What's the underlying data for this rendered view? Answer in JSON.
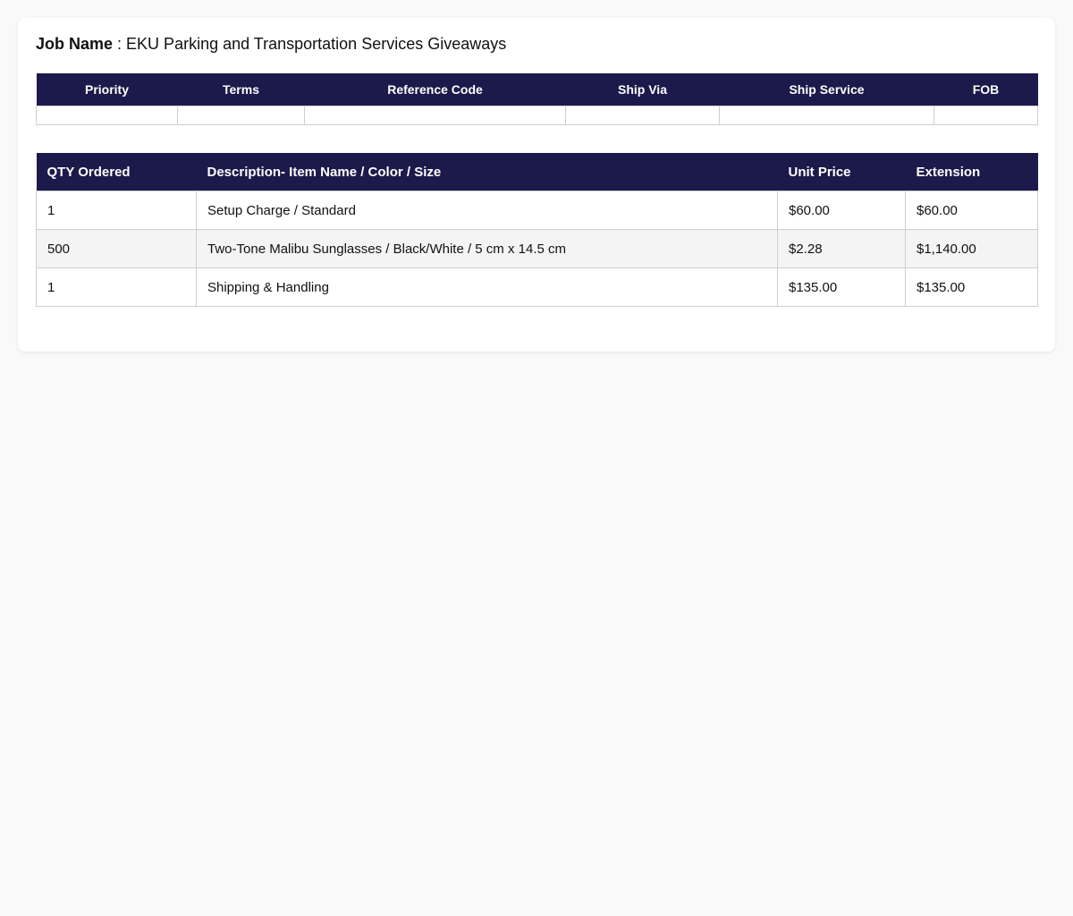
{
  "job": {
    "label": "Job Name",
    "separator": " : ",
    "name": "EKU Parking and Transportation Services Giveaways"
  },
  "meta_table": {
    "headers": [
      "Priority",
      "Terms",
      "Reference Code",
      "Ship Via",
      "Ship Service",
      "FOB"
    ],
    "values": [
      "",
      "",
      "",
      "",
      "",
      ""
    ]
  },
  "items_table": {
    "headers": [
      "QTY Ordered",
      "Description- Item Name / Color / Size",
      "Unit Price",
      "Extension"
    ],
    "rows": [
      {
        "qty": "1",
        "description": "Setup Charge / Standard",
        "unit_price": "$60.00",
        "extension": "$60.00"
      },
      {
        "qty": "500",
        "description": "Two-Tone Malibu Sunglasses / Black/White / 5 cm x 14.5 cm",
        "unit_price": "$2.28",
        "extension": "$1,140.00"
      },
      {
        "qty": "1",
        "description": "Shipping & Handling",
        "unit_price": "$135.00",
        "extension": "$135.00"
      }
    ]
  },
  "colors": {
    "header_bg": "#1c1a4b",
    "header_text": "#ffffff",
    "alt_row_bg": "#f4f4f4",
    "page_bg": "#f9f9f9"
  }
}
